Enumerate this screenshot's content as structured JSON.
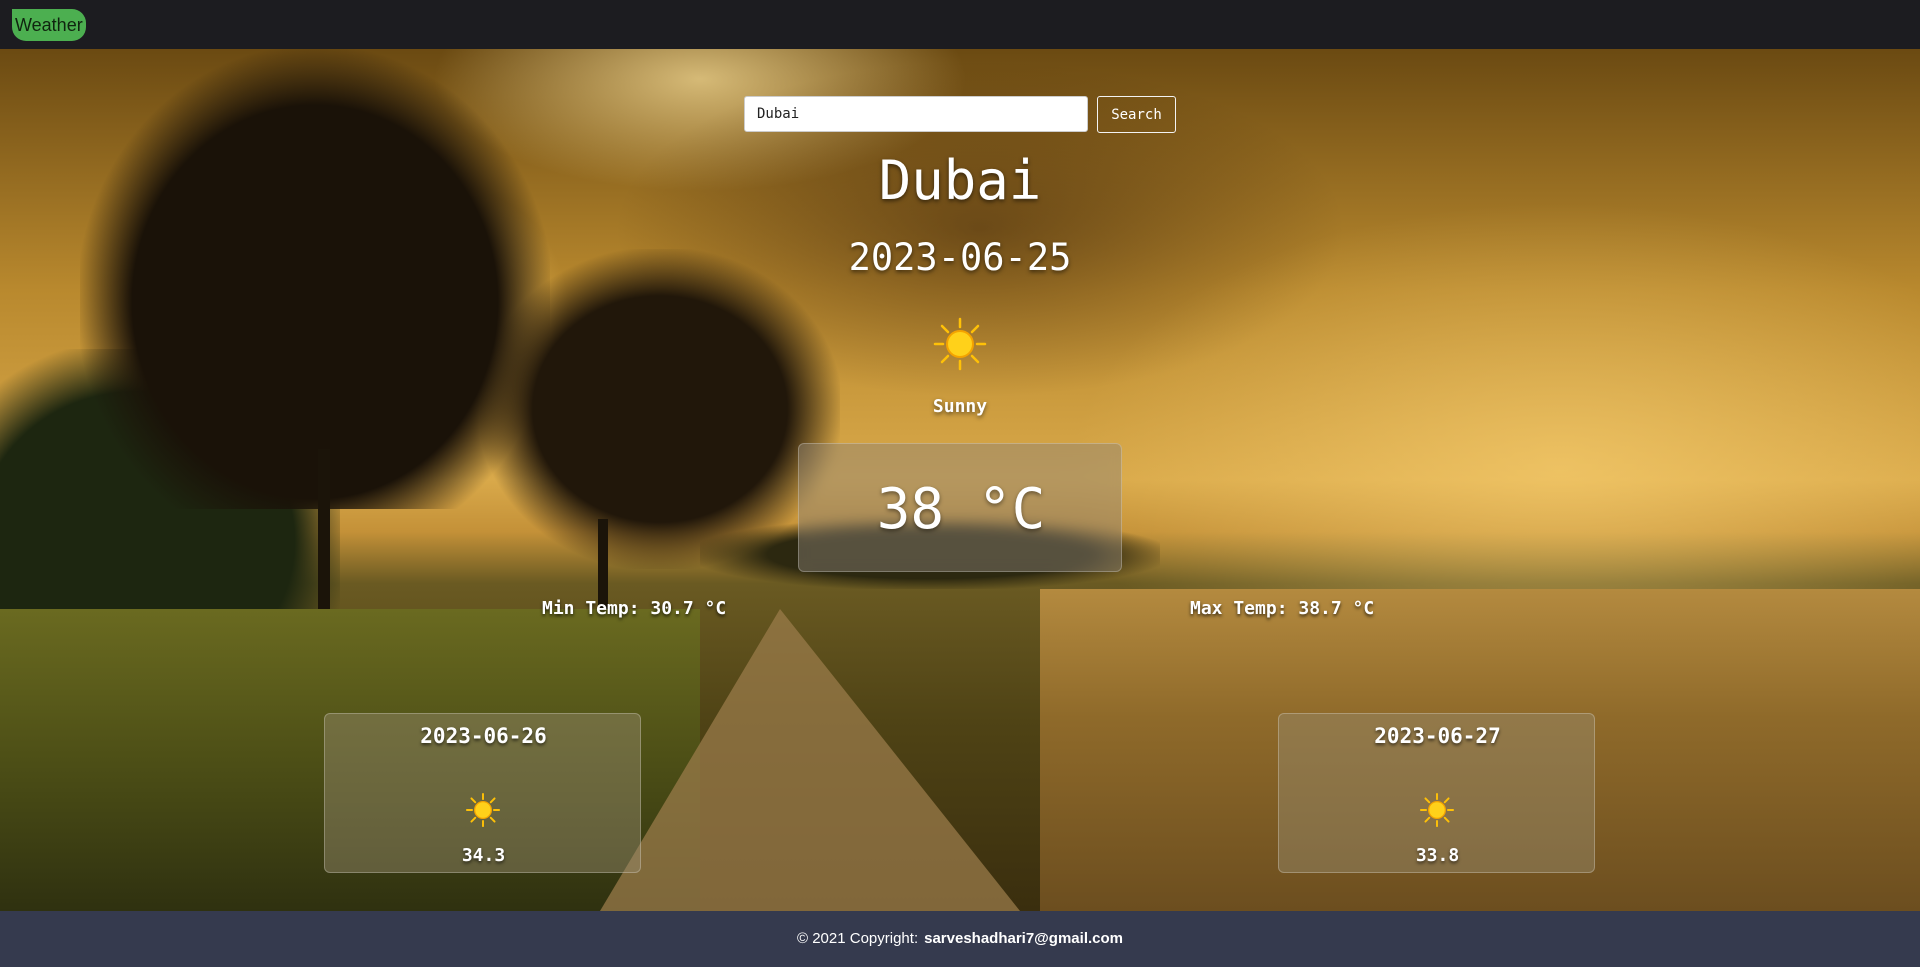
{
  "navbar": {
    "brand": "Weather"
  },
  "search": {
    "value": "Dubai",
    "button_label": "Search"
  },
  "current": {
    "city": "Dubai",
    "date": "2023-06-25",
    "condition": "Sunny",
    "condition_icon": "sun-icon",
    "temperature": "38 °C",
    "min_temp": "Min Temp: 30.7 °C",
    "max_temp": "Max Temp: 38.7 °C"
  },
  "forecast": [
    {
      "date": "2023-06-26",
      "icon": "sun-icon",
      "temp": "34.3"
    },
    {
      "date": "2023-06-27",
      "icon": "sun-icon",
      "temp": "33.8"
    }
  ],
  "footer": {
    "text": "© 2021 Copyright:",
    "email": "sarveshadhari7@gmail.com"
  },
  "colors": {
    "navbar_bg": "#1c1c20",
    "brand_bg": "#4caf50",
    "footer_bg": "#353a4e",
    "sun": "#ffc107"
  }
}
